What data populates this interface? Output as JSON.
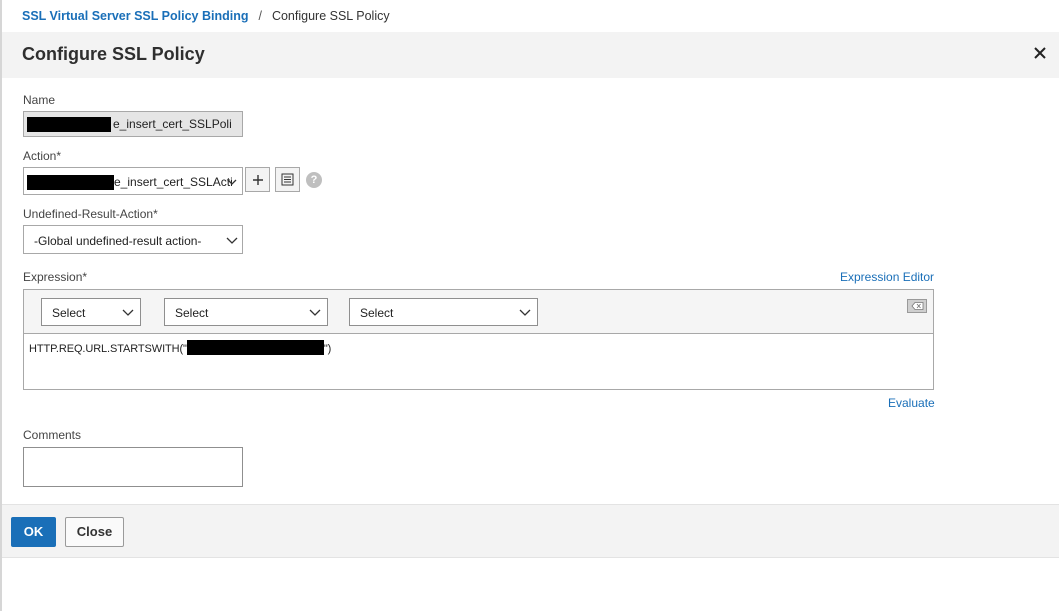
{
  "breadcrumb": {
    "parent": "SSL Virtual Server SSL Policy Binding",
    "separator": "/",
    "current": "Configure SSL Policy"
  },
  "dialog": {
    "title": "Configure SSL Policy",
    "close_icon": "close-icon"
  },
  "form": {
    "name": {
      "label": "Name",
      "value": "e_insert_cert_SSLPoli"
    },
    "action": {
      "label": "Action*",
      "value": "e_insert_cert_SSLActi",
      "add_icon": "plus-icon",
      "edit_icon": "list-icon",
      "help_icon": "help-icon",
      "help_glyph": "?"
    },
    "undefined_result_action": {
      "label": "Undefined-Result-Action*",
      "value": "-Global undefined-result action-"
    },
    "expression": {
      "label": "Expression*",
      "editor_link": "Expression Editor",
      "selects": [
        "Select",
        "Select",
        "Select"
      ],
      "clear_icon": "clear-icon",
      "text_prefix": "HTTP.REQ.URL.STARTSWITH(\"",
      "text_suffix": "\")",
      "evaluate_link": "Evaluate"
    },
    "comments": {
      "label": "Comments",
      "value": ""
    }
  },
  "footer": {
    "ok_label": "OK",
    "close_label": "Close"
  },
  "colors": {
    "link": "#1a6fb8",
    "primary_button": "#1a6fb8",
    "panel_bg": "#f3f3f3"
  }
}
